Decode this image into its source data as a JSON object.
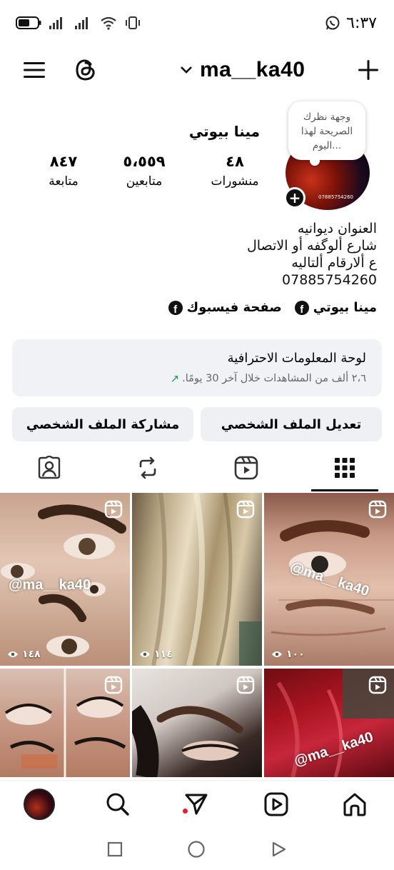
{
  "status_bar": {
    "time": "٦:٣٧"
  },
  "header": {
    "username": "ma__ka40"
  },
  "profile": {
    "display_name": "مينا بيوتي",
    "note": [
      "وجهة نظرك",
      "الصريحة لهذا",
      "اليوم..."
    ],
    "avatar_text": "07885754260",
    "stats": [
      {
        "value": "٤٨",
        "label": "منشورات"
      },
      {
        "value": "٥،٥٥٩",
        "label": "متابعين"
      },
      {
        "value": "٨٤٧",
        "label": "متابعة"
      }
    ],
    "bio_lines": [
      "العنوان ديوانيه",
      "شارع ألوگفه أو الاتصال",
      "ع ألارقام ألتاليه",
      "07885754260"
    ],
    "links": [
      {
        "label": "مينا بيوتي"
      },
      {
        "label": "صفحة فيسبوك"
      }
    ]
  },
  "dashboard": {
    "title": "لوحة المعلومات الاحترافية",
    "subtitle": "٢،٦ ألف من المشاهدات خلال آخر 30 يومًا."
  },
  "buttons": {
    "edit_profile": "تعديل الملف الشخصي",
    "share_profile": "مشاركة الملف الشخصي"
  },
  "grid": {
    "watermark": "@ma__ka40",
    "views": [
      "١٠٠",
      "١١٤",
      "١٤٨"
    ]
  },
  "colors": {
    "accent_green": "#1a9c3c",
    "notification_red": "#e0202a",
    "button_bg": "#eef0f3",
    "card_bg": "#f0f2f5"
  }
}
